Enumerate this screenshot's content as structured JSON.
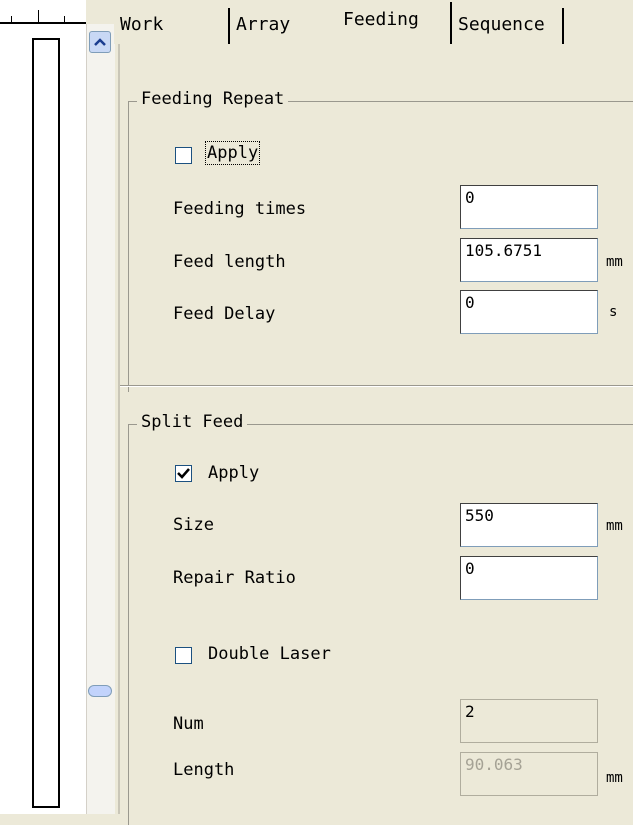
{
  "tabs": [
    {
      "label": "Work"
    },
    {
      "label": "Array"
    },
    {
      "label": "Feeding"
    },
    {
      "label": "Sequence"
    }
  ],
  "active_tab": "Feeding",
  "feeding_repeat": {
    "title": "Feeding Repeat",
    "apply_label": "Apply",
    "apply_checked": false,
    "feeding_times_label": "Feeding times",
    "feeding_times_value": "0",
    "feed_length_label": "Feed length",
    "feed_length_value": "105.6751",
    "feed_length_unit": "mm",
    "feed_delay_label": "Feed Delay",
    "feed_delay_value": "0",
    "feed_delay_unit": "s"
  },
  "split_feed": {
    "title": "Split Feed",
    "apply_label": "Apply",
    "apply_checked": true,
    "size_label": "Size",
    "size_value": "550",
    "size_unit": "mm",
    "repair_ratio_label": "Repair Ratio",
    "repair_ratio_value": "0",
    "double_laser_label": "Double Laser",
    "double_laser_checked": false,
    "num_label": "Num",
    "num_value": "2",
    "length_label": "Length",
    "length_value": "90.063",
    "length_unit": "mm"
  },
  "icons": {
    "scroll_up": "chevron-up-icon",
    "check": "checkmark-icon"
  }
}
